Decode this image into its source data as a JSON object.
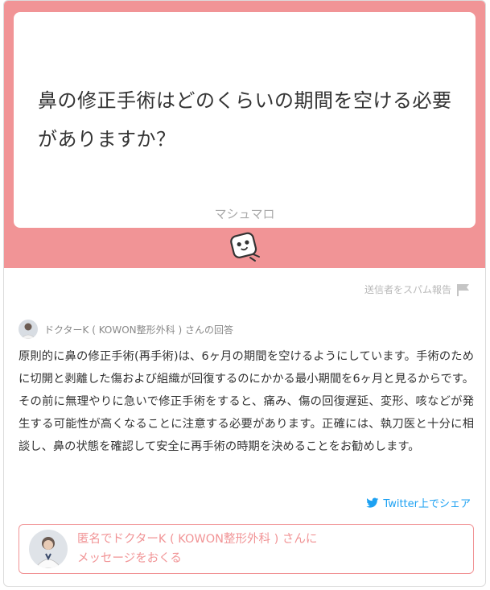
{
  "question": {
    "text_line1": "鼻の修正手術はどのくらいの期間を空ける必要",
    "text_line2": "がありますか？",
    "source_label": "マシュマロ"
  },
  "report": {
    "label": "送信者をスパム報告"
  },
  "answer": {
    "answerer_label": "ドクターK ( KOWON整形外科 ) さんの回答",
    "body": "原則的に鼻の修正手術(再手術)は、6ヶ月の期間を空けるようにしています。手術のために切開と剥離した傷および組織が回復するのにかかる最小期間を6ヶ月と見るからです。 その前に無理やりに急いで修正手術をすると、痛み、傷の回復遅延、変形、咳などが発生する可能性が高くなることに注意する必要があります。正確には、執刀医と十分に相談し、鼻の状態を確認して安全に再手術の時期を決めることをお勧めします。"
  },
  "share": {
    "label": "Twitter上でシェア"
  },
  "cta": {
    "line1": "匿名でドクターK ( KOWON整形外科 ) さんに",
    "line2": "メッセージをおくる"
  },
  "colors": {
    "accent": "#f19496",
    "twitter": "#1da1f2"
  },
  "icons": [
    "marshmallow-mascot-icon",
    "flag-icon",
    "twitter-icon",
    "doctor-avatar"
  ]
}
